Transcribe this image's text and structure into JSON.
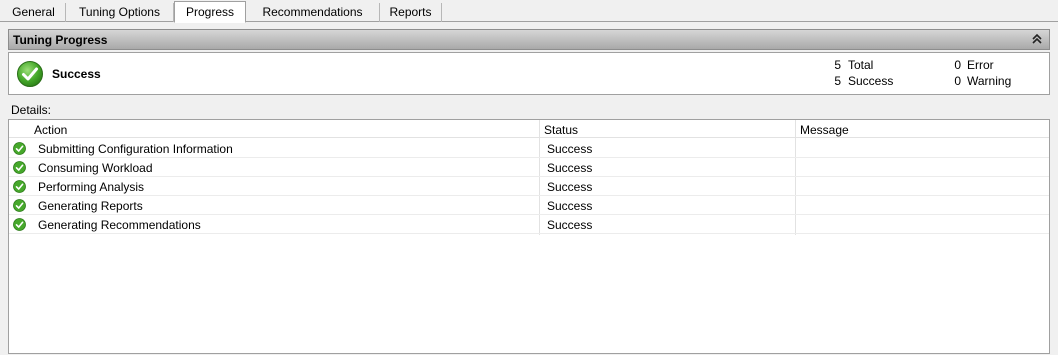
{
  "tabs": [
    {
      "label": "General"
    },
    {
      "label": "Tuning Options"
    },
    {
      "label": "Progress"
    },
    {
      "label": "Recommendations"
    },
    {
      "label": "Reports"
    }
  ],
  "section": {
    "title": "Tuning Progress",
    "collapse_icon": "double-chevron-up-icon"
  },
  "summary": {
    "status_icon": "success-check-icon",
    "status": "Success",
    "total_count": "5",
    "total_label": "Total",
    "success_count": "5",
    "success_label": "Success",
    "error_count": "0",
    "error_label": "Error",
    "warning_count": "0",
    "warning_label": "Warning"
  },
  "details": {
    "label": "Details:",
    "columns": [
      "Action",
      "Status",
      "Message"
    ],
    "rows": [
      {
        "action": "Submitting Configuration Information",
        "status": "Success",
        "message": ""
      },
      {
        "action": "Consuming Workload",
        "status": "Success",
        "message": ""
      },
      {
        "action": "Performing Analysis",
        "status": "Success",
        "message": ""
      },
      {
        "action": "Generating Reports",
        "status": "Success",
        "message": ""
      },
      {
        "action": "Generating Recommendations",
        "status": "Success",
        "message": ""
      }
    ]
  },
  "colors": {
    "success_green": "#3fa11e",
    "header_gray": "#a9a9a9"
  }
}
